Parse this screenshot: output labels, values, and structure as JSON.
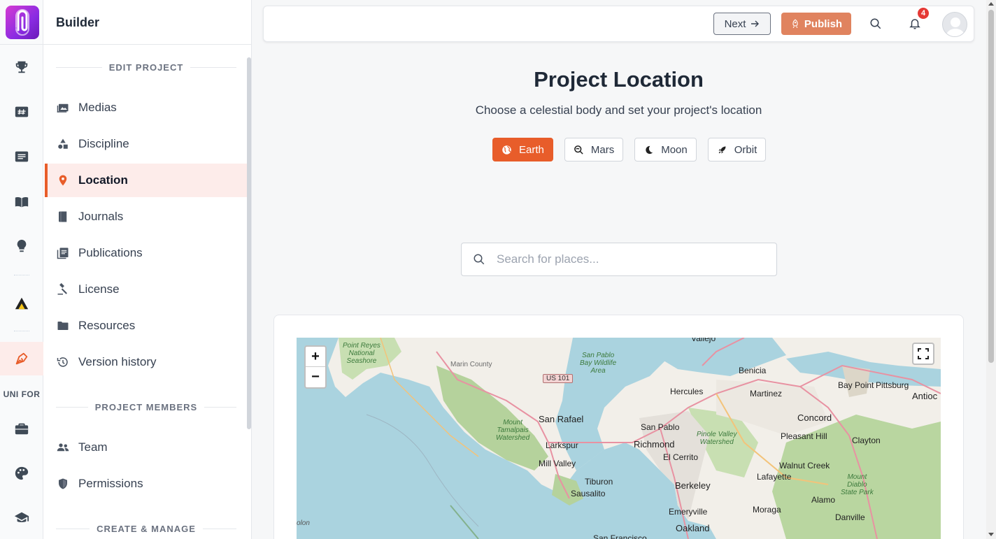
{
  "app": {
    "panel_title": "Builder"
  },
  "rail": {
    "section_label": "UNI FOR"
  },
  "sidebar": {
    "sections": [
      {
        "label": "EDIT PROJECT"
      },
      {
        "label": "PROJECT MEMBERS"
      },
      {
        "label": "CREATE & MANAGE"
      }
    ],
    "items": [
      {
        "label": "Medias",
        "icon": "images-icon"
      },
      {
        "label": "Discipline",
        "icon": "shapes-icon"
      },
      {
        "label": "Location",
        "icon": "map-pin-icon",
        "active": true
      },
      {
        "label": "Journals",
        "icon": "journal-icon"
      },
      {
        "label": "Publications",
        "icon": "publications-icon"
      },
      {
        "label": "License",
        "icon": "gavel-icon"
      },
      {
        "label": "Resources",
        "icon": "folder-icon"
      },
      {
        "label": "Version history",
        "icon": "history-icon"
      },
      {
        "label": "Team",
        "icon": "team-icon"
      },
      {
        "label": "Permissions",
        "icon": "shield-icon"
      }
    ]
  },
  "topbar": {
    "next_label": "Next",
    "publish_label": "Publish",
    "notification_count": "4"
  },
  "main": {
    "title": "Project Location",
    "subtitle": "Choose a celestial body and set your project's location",
    "bodies": [
      {
        "label": "Earth",
        "icon": "globe-icon",
        "active": true
      },
      {
        "label": "Mars",
        "icon": "planet-search-icon"
      },
      {
        "label": "Moon",
        "icon": "moon-icon"
      },
      {
        "label": "Orbit",
        "icon": "rocket-icon"
      }
    ],
    "search": {
      "placeholder": "Search for places..."
    }
  },
  "map": {
    "zoom_in": "+",
    "zoom_out": "−",
    "labels": {
      "point_reyes": "Point Reyes\nNational\nSeashore",
      "marin_county": "Marin County",
      "us101": "US 101",
      "san_pablo_bay": "San Pablo\nBay Wildlife\nArea",
      "hercules": "Hercules",
      "benicia": "Benicia",
      "martinez": "Martinez",
      "bay_point": "Bay Point",
      "pittsburg": "Pittsburg",
      "antioch": "Antioc",
      "concord": "Concord",
      "san_rafael": "San Rafael",
      "mount_tamalpais": "Mount\nTamalpais\nWatershed",
      "san_pablo": "San Pablo",
      "pinole": "Pinole Valley\nWatershed",
      "pleasant_hill": "Pleasant Hill",
      "clayton": "Clayton",
      "larkspur": "Larkspur",
      "richmond": "Richmond",
      "el_cerrito": "El Cerrito",
      "mill_valley": "Mill Valley",
      "walnut_creek": "Walnut Creek",
      "tiburon": "Tiburon",
      "berkeley": "Berkeley",
      "lafayette": "Lafayette",
      "mount_diablo": "Mount\nDiablo\nState Park",
      "sausalito": "Sausalito",
      "alamo": "Alamo",
      "emeryville": "Emeryville",
      "moraga": "Moraga",
      "danville": "Danville",
      "oakland": "Oakland",
      "san_francisco": "San Francisco",
      "vallejo": "Vallejo",
      "olon": "olon"
    }
  },
  "colors": {
    "accent": "#e85d2a",
    "publish": "#e0835f",
    "active_bg": "#fdecea",
    "water": "#aad3df"
  }
}
